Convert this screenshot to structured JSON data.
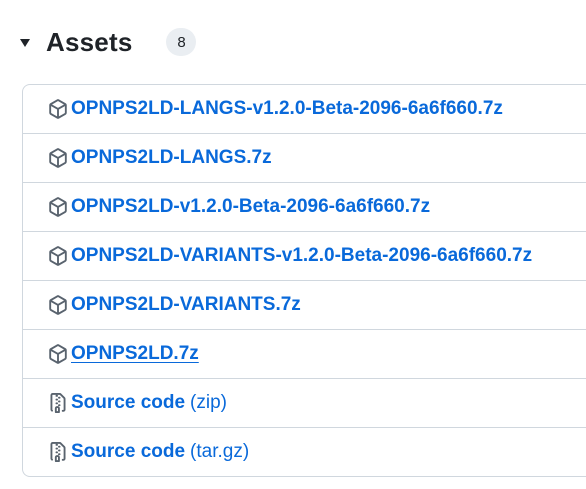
{
  "assets": {
    "title": "Assets",
    "count": "8",
    "items": [
      {
        "name": "OPNPS2LD-LANGS-v1.2.0-Beta-2096-6a6f660.7z",
        "icon": "package-icon",
        "suffix": ""
      },
      {
        "name": "OPNPS2LD-LANGS.7z",
        "icon": "package-icon",
        "suffix": ""
      },
      {
        "name": "OPNPS2LD-v1.2.0-Beta-2096-6a6f660.7z",
        "icon": "package-icon",
        "suffix": ""
      },
      {
        "name": "OPNPS2LD-VARIANTS-v1.2.0-Beta-2096-6a6f660.7z",
        "icon": "package-icon",
        "suffix": ""
      },
      {
        "name": "OPNPS2LD-VARIANTS.7z",
        "icon": "package-icon",
        "suffix": ""
      },
      {
        "name": "OPNPS2LD.7z",
        "icon": "package-icon",
        "suffix": ""
      },
      {
        "name": "Source code",
        "icon": "file-zip-icon",
        "suffix": "(zip)"
      },
      {
        "name": "Source code",
        "icon": "file-zip-icon",
        "suffix": "(tar.gz)"
      }
    ]
  },
  "colors": {
    "link": "#0969da",
    "text": "#1f2328",
    "border": "#d0d7de",
    "icon": "#59636e",
    "badge_bg": "#eaeef2"
  }
}
